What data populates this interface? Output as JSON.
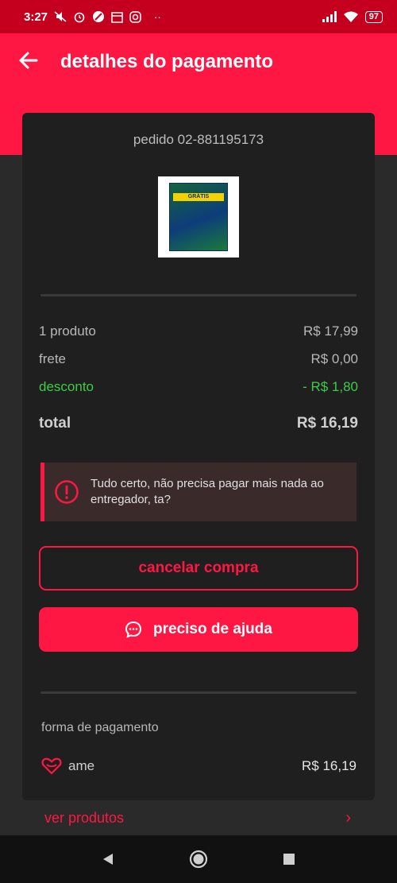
{
  "status_bar": {
    "time": "3:27",
    "battery": "97",
    "left_icons": [
      "mute-icon",
      "alarm-icon",
      "no-entry-icon",
      "calendar-icon",
      "instagram-icon"
    ],
    "more": "··"
  },
  "header": {
    "title": "detalhes do pagamento"
  },
  "order": {
    "id_label": "pedido 02-881195173"
  },
  "product": {
    "badge": "GRÁTIS"
  },
  "summary": {
    "rows": [
      {
        "label": "1 produto",
        "value": "R$ 17,99"
      },
      {
        "label": "frete",
        "value": "R$ 0,00"
      },
      {
        "label": "desconto",
        "value": "- R$ 1,80"
      }
    ],
    "total_label": "total",
    "total_value": "R$ 16,19"
  },
  "notice": {
    "text": "Tudo certo, não precisa pagar mais nada ao entregador, ta?"
  },
  "actions": {
    "cancel_label": "cancelar compra",
    "help_label": "preciso de ajuda"
  },
  "payment": {
    "section_label": "forma de pagamento",
    "method": "ame",
    "amount": "R$ 16,19"
  },
  "footer_link": {
    "label": "ver produtos",
    "chevron": "›"
  },
  "colors": {
    "accent": "#ff1744",
    "discount": "#3dcc45",
    "status_bar": "#c4001e"
  }
}
